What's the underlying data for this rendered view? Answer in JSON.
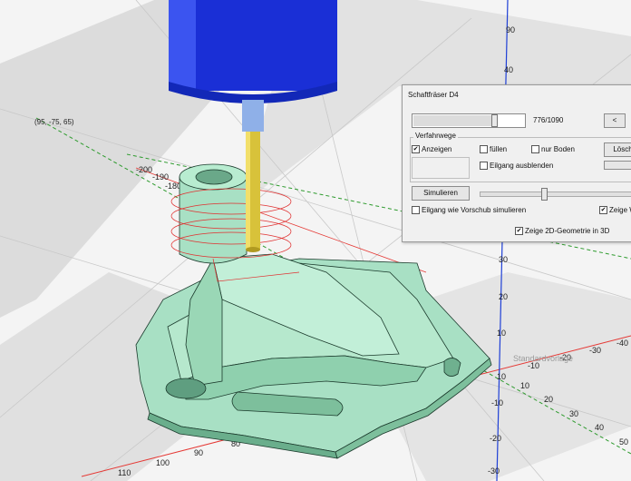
{
  "viewport": {
    "coordinate_readout": "(95, -75, 65)",
    "axis_ticks": {
      "x_left": [
        "-200",
        "-190",
        "-180"
      ],
      "x_right": [
        "90",
        "-10",
        "-20",
        "-30",
        "-40"
      ],
      "y_upper": [
        "90",
        "40",
        "30",
        "20",
        "10"
      ],
      "y_lower": [
        "10",
        "-10",
        "-20",
        "-30"
      ],
      "front": [
        "110",
        "100",
        "90",
        "80"
      ],
      "right_front": [
        "10",
        "20",
        "30",
        "40",
        "50"
      ]
    },
    "axis_caption": "Standardvorlage"
  },
  "dialog": {
    "title": "Schaftfräser D4",
    "counter": "776/1090",
    "nav_button": "<",
    "group_title": "Verfahrwege",
    "show_label": "Anzeigen",
    "fill_label": "füllen",
    "bottom_only_label": "nur Boden",
    "delete_button": "Lösch",
    "hide_entry_label": "Eilgang ausblenden",
    "simulate_button": "Simulieren",
    "rapid_as_feed_label": "Eilgang wie Vorschub simulieren",
    "show_tool_label": "Zeige W",
    "show_2d_label": "Zeige 2D-Geometrie in 3D",
    "checks": {
      "show": true,
      "fill": false,
      "bottom_only": false,
      "hide_entry": false,
      "rapid_as_feed": false,
      "show_tool": true,
      "show_2d": true
    },
    "progress_fraction": 0.711,
    "sim_speed_fraction": 0.4
  },
  "colors": {
    "part": "#a8e0c4",
    "part_shadow": "#7fc7a4",
    "spindle": "#1a2fd6",
    "tool_shank": "#d8c23a",
    "toolpath": "#e03030",
    "grid_dark": "#d9d9d9",
    "axis_x": "#e53935",
    "axis_y": "#1e3fd6",
    "axis_z": "#2e9b2e"
  }
}
